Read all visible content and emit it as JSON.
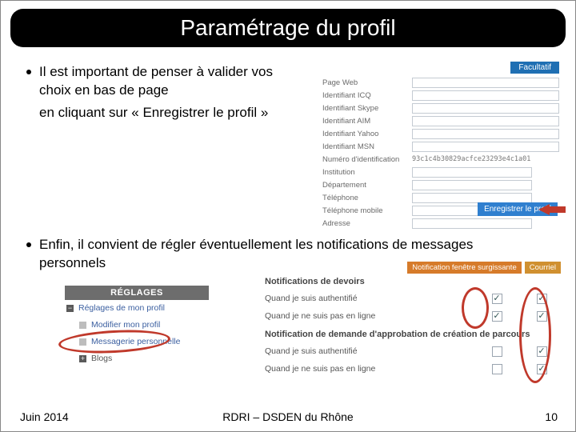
{
  "title": "Paramétrage du profil",
  "bullet1": "Il est important de penser à valider vos choix en bas de page",
  "bullet1b": "en cliquant sur « Enregistrer le profil »",
  "form": {
    "facultatif": "Facultatif",
    "rows": {
      "page_web": "Page Web",
      "icq": "Identifiant ICQ",
      "skype": "Identifiant Skype",
      "aim": "Identifiant AIM",
      "yahoo": "Identifiant Yahoo",
      "msn": "Identifiant MSN",
      "num_id": "Numéro d'identification",
      "num_id_value": "93c1c4b30829acfce23293e4c1a01",
      "institution": "Institution",
      "departement": "Département",
      "telephone": "Téléphone",
      "tel_mobile": "Téléphone mobile",
      "adresse": "Adresse"
    },
    "save_btn": "Enregistrer le profil"
  },
  "bullet2": "Enfin, il convient de régler éventuellement les notifications de messages personnels",
  "settings": {
    "header": "RÉGLAGES",
    "item1": "Réglages de mon profil",
    "item2": "Modifier mon profil",
    "item3": "Messagerie personnelle",
    "item4": "Blogs"
  },
  "notif": {
    "chip1": "Notification fenêtre surgissante",
    "chip2": "Courriel",
    "title1": "Notifications de devoirs",
    "r1": "Quand je suis authentifié",
    "r2": "Quand je ne suis pas en ligne",
    "title2": "Notification de demande d'approbation de création de parcours",
    "r3": "Quand je suis authentifié",
    "r4": "Quand je ne suis pas en ligne"
  },
  "footer": {
    "left": "Juin 2014",
    "center": "RDRI – DSDEN du Rhône",
    "right": "10"
  }
}
